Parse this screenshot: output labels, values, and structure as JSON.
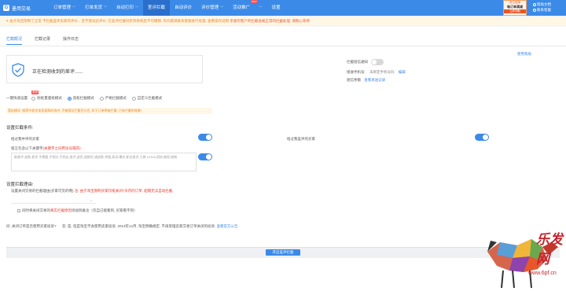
{
  "app": {
    "name": "墨用交易",
    "logo_glyph": "G"
  },
  "nav": [
    {
      "label": "订单管理",
      "caret": "﹀"
    },
    {
      "label": "打单发货",
      "caret": "﹀"
    },
    {
      "label": "自动打印",
      "caret": "﹀"
    },
    {
      "label": "差评拦截",
      "caret": ""
    },
    {
      "label": "自动评价",
      "caret": ""
    },
    {
      "label": "评价管理",
      "caret": "﹀"
    },
    {
      "label": "活动推广",
      "caret": "﹀",
      "badge": "new"
    },
    {
      "label": "设置",
      "caret": ""
    }
  ],
  "promo": {
    "top": "双旦促销",
    "middle": "每订单满减",
    "bottom": "立即领取"
  },
  "user_links": [
    "帮助文档",
    "联系客服"
  ],
  "alert": {
    "prefix": "☀ 由于淘宝限制了正常",
    "text": "不拦截差评卖家的评价、且不受动态评价, 在差评拦截同步到系统后不可撤销, 有问题请联系客服进行处理, 查看操作说明",
    "warn": "亲爱的客户的拦截会被正常的拦截处理, 请耐心等待"
  },
  "tabs": [
    "拦截概况",
    "拦截记录",
    "操作日志"
  ],
  "status": {
    "text": "正在检测收到的差评......"
  },
  "help_link": "使用帮助",
  "notify": {
    "label": "拦截短信通知"
  },
  "phone": {
    "label": "接收手机号:",
    "value": "未绑定手机号码",
    "action": "编辑"
  },
  "sms": {
    "label": "短信余额",
    "action": "查看发送记录"
  },
  "mode": {
    "label": "一键快速设置:",
    "recommend_badge": "推荐",
    "options": [
      "防批量骚扰模式",
      "宽松拦截模式",
      "严格拦截模式",
      "自定义拦截模式"
    ],
    "selected_index": 1
  },
  "mode_note": "宽松模式: 推荐中差评卖家复购时选中, 不能保证拦截百分百, 如下订单将被拦截, 已有拦截的效果!",
  "conditions": {
    "title": "设置拦截条件:",
    "rule1": "给过我中评的买家",
    "rule2": "给过我差评的买家",
    "keyword_label": "留言包含以下关键字",
    "keyword_hint": "(关键字之间用逗号隔开):",
    "keywords": "取差评,退款,差评,不想要,不划分,不划去,差评,退货,退换货,请退款,举报,投诉,曝光,职业差评,工商,12315,消协,维权,收纳"
  },
  "reason": {
    "title": "设置拦截理由:",
    "label": "设置关闭交易的拦截理由(买家可见的哦)",
    "warning": "注: 由于淘宝限制买家仅能关闭7天内的订单, 超期无法自动拦截,",
    "memo_prefix": "同时将关闭交易的",
    "memo_highlight": "真实拦截原因",
    "memo_suffix": "添加到备注（仅自己能看到, 买家看不到）"
  },
  "qa": {
    "question": "问: 关闭订单是否使用买家投诉?",
    "answer": "答: 是, 但是淘宝不会使用卖家投诉, 2013年12月, 淘宝明确规定, 不再受理卖家交易订单关闭的投诉;",
    "link": "查看官方公告"
  },
  "start_button": "开启差评拦截",
  "watermark": {
    "text": "乐发网",
    "url": "www.6pf.cn"
  },
  "colors": {
    "primary": "#3b8ae8",
    "warn": "#e8862a",
    "danger": "#e8362a"
  }
}
